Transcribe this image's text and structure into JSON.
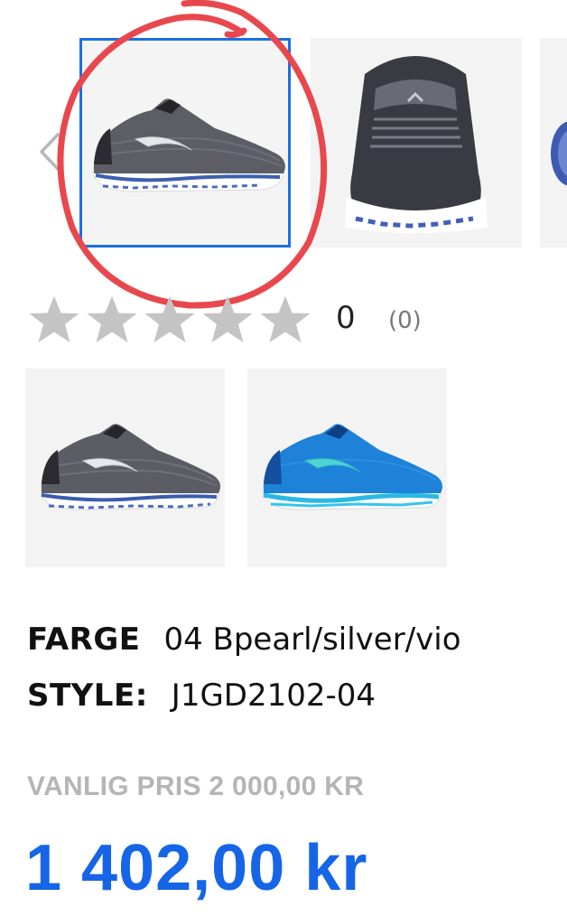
{
  "gallery": {
    "prev_icon": "chevron-left-icon",
    "thumbnails": [
      {
        "alt": "Grey running shoe side view",
        "selected": true
      },
      {
        "alt": "Shoe heel back view",
        "selected": false
      },
      {
        "alt": "Partial shoe view",
        "selected": false
      }
    ]
  },
  "rating": {
    "stars_filled": 0,
    "stars_total": 5,
    "score": "0",
    "count": "(0)"
  },
  "swatches": [
    {
      "name": "grey-pearl",
      "color": "#5a5a62"
    },
    {
      "name": "blue",
      "color": "#1e7fd6"
    }
  ],
  "product": {
    "color_label": "FARGE",
    "color_value": "04 Bpearl/silver/vio",
    "style_label": "STYLE:",
    "style_value": "J1GD2102-04"
  },
  "price": {
    "regular": "VANLIG PRIS 2 000,00 KR",
    "sale": "1 402,00 kr"
  },
  "colors": {
    "accent": "#1565e6",
    "selection_border": "#1a6fe8",
    "annotation": "#e8484d",
    "star_empty": "#c4c4c4"
  }
}
